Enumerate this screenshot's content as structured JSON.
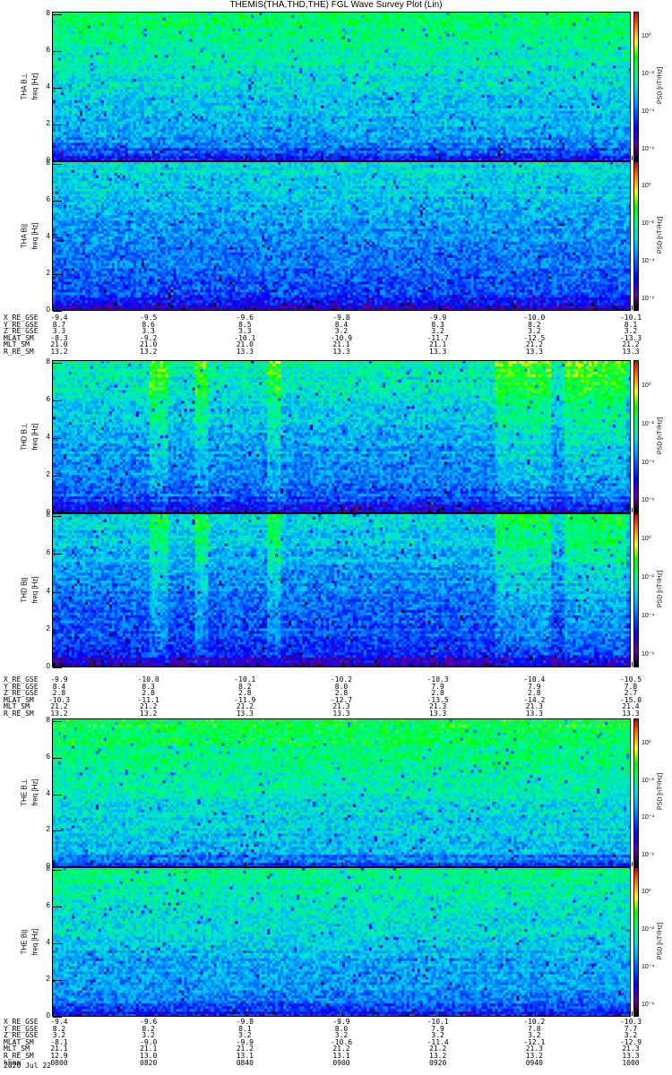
{
  "title": "THEMIS(THA,THD,THE) FGL Wave Survey Plot (Lin)",
  "colors": {
    "colormap": [
      "#000000",
      "#6a0090",
      "#0000ff",
      "#00a0ff",
      "#00e0e0",
      "#00ff60",
      "#00ff00",
      "#ffff00",
      "#ff8000",
      "#d00000"
    ]
  },
  "chart_data": {
    "type": "heatmap",
    "title": "THEMIS(THA,THD,THE) FGL Wave Survey Plot (Lin)",
    "xlabel": "hhmm",
    "x_range": [
      "0800",
      "1000"
    ],
    "x_ticks": [
      "0800",
      "0820",
      "0840",
      "0900",
      "0920",
      "0940",
      "1000"
    ],
    "date": "2020 Jul 22",
    "colorbar": {
      "label": "PSD [nT²/Hz]",
      "scale": "log",
      "range": [
        -7,
        1
      ],
      "ticks": [
        "10⁰",
        "10⁻²",
        "10⁻⁴",
        "10⁻⁶"
      ]
    },
    "panels": [
      {
        "probe": "THA",
        "label": "THA B⊥",
        "ylabel": "freq [Hz]",
        "ylim": [
          0,
          8
        ],
        "yticks": [
          "0",
          "2",
          "4",
          "6",
          "8"
        ],
        "level": 0.58,
        "bursts": []
      },
      {
        "probe": "THA",
        "label": "THA B||",
        "ylabel": "freq [Hz]",
        "ylim": [
          0,
          8
        ],
        "yticks": [
          "0",
          "2",
          "4",
          "6",
          "8"
        ],
        "level": 0.48,
        "bursts": []
      },
      {
        "probe": "THD",
        "label": "THD B⊥",
        "ylabel": "freq [Hz]",
        "ylim": [
          0,
          8
        ],
        "yticks": [
          "0",
          "2",
          "4",
          "6",
          "8"
        ],
        "level": 0.52,
        "bursts": [
          [
            0.165,
            0.195
          ],
          [
            0.245,
            0.265
          ],
          [
            0.37,
            0.39
          ],
          [
            0.76,
            0.86
          ],
          [
            0.88,
            0.99
          ]
        ]
      },
      {
        "probe": "THD",
        "label": "THD B||",
        "ylabel": "freq [Hz]",
        "ylim": [
          0,
          8
        ],
        "yticks": [
          "0",
          "2",
          "4",
          "6",
          "8"
        ],
        "level": 0.46,
        "bursts": [
          [
            0.165,
            0.195
          ],
          [
            0.245,
            0.265
          ],
          [
            0.37,
            0.39
          ],
          [
            0.76,
            0.86
          ],
          [
            0.88,
            0.99
          ]
        ]
      },
      {
        "probe": "THE",
        "label": "THE B⊥",
        "ylabel": "freq [Hz]",
        "ylim": [
          0,
          8
        ],
        "yticks": [
          "0",
          "2",
          "4",
          "6",
          "8"
        ],
        "level": 0.62,
        "bursts": []
      },
      {
        "probe": "THE",
        "label": "THE B||",
        "ylabel": "freq [Hz]",
        "ylim": [
          0,
          8
        ],
        "yticks": [
          "0",
          "2",
          "4",
          "6",
          "8"
        ],
        "level": 0.55,
        "bursts": []
      }
    ],
    "ephemeris": [
      {
        "probe": "THA",
        "rows": [
          {
            "name": "X_RE_GSE",
            "values": [
              "-9.4",
              "-9.5",
              "-9.6",
              "-9.8",
              "-9.9",
              "-10.0",
              "-10.1"
            ]
          },
          {
            "name": "Y_RE_GSE",
            "values": [
              "8.7",
              "8.6",
              "8.5",
              "8.4",
              "8.3",
              "8.2",
              "8.1"
            ]
          },
          {
            "name": "Z_RE_GSE",
            "values": [
              "3.3",
              "3.3",
              "3.3",
              "3.2",
              "3.2",
              "3.2",
              "3.2"
            ]
          },
          {
            "name": "MLAT_SM",
            "values": [
              "-8.3",
              "-9.2",
              "-10.1",
              "-10.9",
              "-11.7",
              "-12.5",
              "-13.3"
            ]
          },
          {
            "name": "MLT_SM",
            "values": [
              "21.0",
              "21.0",
              "21.0",
              "21.1",
              "21.1",
              "21.2",
              "21.2"
            ]
          },
          {
            "name": "R_RE_SM",
            "values": [
              "13.2",
              "13.2",
              "13.3",
              "13.3",
              "13.3",
              "13.3",
              "13.3"
            ]
          }
        ]
      },
      {
        "probe": "THD",
        "rows": [
          {
            "name": "X_RE_GSE",
            "values": [
              "-9.9",
              "-10.0",
              "-10.1",
              "-10.2",
              "-10.3",
              "-10.4",
              "-10.5"
            ]
          },
          {
            "name": "Y_RE_GSE",
            "values": [
              "8.4",
              "8.3",
              "8.2",
              "8.0",
              "7.9",
              "7.9",
              "7.8"
            ]
          },
          {
            "name": "Z_RE_GSE",
            "values": [
              "2.8",
              "2.8",
              "2.8",
              "2.8",
              "2.8",
              "2.8",
              "2.7"
            ]
          },
          {
            "name": "MLAT_SM",
            "values": [
              "-10.3",
              "-11.1",
              "-11.9",
              "-12.7",
              "-13.5",
              "-14.2",
              "-15.0"
            ]
          },
          {
            "name": "MLT_SM",
            "values": [
              "21.2",
              "21.2",
              "21.2",
              "21.3",
              "21.3",
              "21.3",
              "21.4"
            ]
          },
          {
            "name": "R_RE_SM",
            "values": [
              "13.2",
              "13.2",
              "13.3",
              "13.3",
              "13.3",
              "13.3",
              "13.3"
            ]
          }
        ]
      },
      {
        "probe": "THE",
        "rows": [
          {
            "name": "X_RE_GSE",
            "values": [
              "-9.4",
              "-9.6",
              "-9.8",
              "-9.9",
              "-10.1",
              "-10.2",
              "-10.3"
            ]
          },
          {
            "name": "Y_RE_GSE",
            "values": [
              "8.2",
              "8.2",
              "8.1",
              "8.0",
              "7.9",
              "7.8",
              "7.7"
            ]
          },
          {
            "name": "Z_RE_GSE",
            "values": [
              "3.2",
              "3.2",
              "3.2",
              "3.2",
              "3.2",
              "3.2",
              "3.2"
            ]
          },
          {
            "name": "MLAT_SM",
            "values": [
              "-8.1",
              "-9.0",
              "-9.9",
              "-10.6",
              "-11.4",
              "-12.1",
              "-12.9"
            ]
          },
          {
            "name": "MLT_SM",
            "values": [
              "21.1",
              "21.1",
              "21.2",
              "21.2",
              "21.2",
              "21.3",
              "21.3"
            ]
          },
          {
            "name": "R_RE_SM",
            "values": [
              "12.9",
              "13.0",
              "13.1",
              "13.1",
              "13.2",
              "13.2",
              "13.3"
            ]
          },
          {
            "name": "hhmm",
            "values": [
              "0800",
              "0820",
              "0840",
              "0900",
              "0920",
              "0940",
              "1000"
            ]
          }
        ]
      }
    ]
  }
}
